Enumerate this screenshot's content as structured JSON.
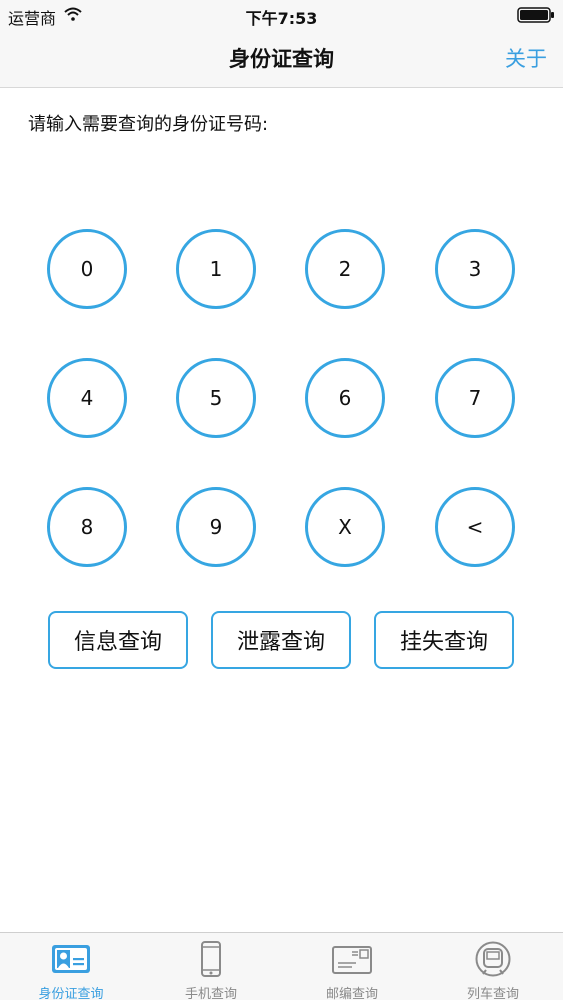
{
  "status_bar": {
    "carrier": "运营商",
    "time": "下午7:53",
    "icons": [
      "wifi-icon",
      "battery-icon"
    ]
  },
  "nav": {
    "title": "身份证查询",
    "right_button": "关于"
  },
  "prompt": "请输入需要查询的身份证号码:",
  "keypad": {
    "keys": [
      "0",
      "1",
      "2",
      "3",
      "4",
      "5",
      "6",
      "7",
      "8",
      "9",
      "X",
      "<"
    ]
  },
  "actions": {
    "info": "信息查询",
    "leak": "泄露查询",
    "loss": "挂失查询"
  },
  "tabs": [
    {
      "label": "身份证查询",
      "icon": "id-card-icon",
      "active": true
    },
    {
      "label": "手机查询",
      "icon": "phone-icon",
      "active": false
    },
    {
      "label": "邮编查询",
      "icon": "envelope-icon",
      "active": false
    },
    {
      "label": "列车查询",
      "icon": "train-icon",
      "active": false
    }
  ],
  "colors": {
    "accent": "#36a6e2",
    "tab_active": "#3a9fe0",
    "tab_inactive": "#8a8a8a"
  }
}
